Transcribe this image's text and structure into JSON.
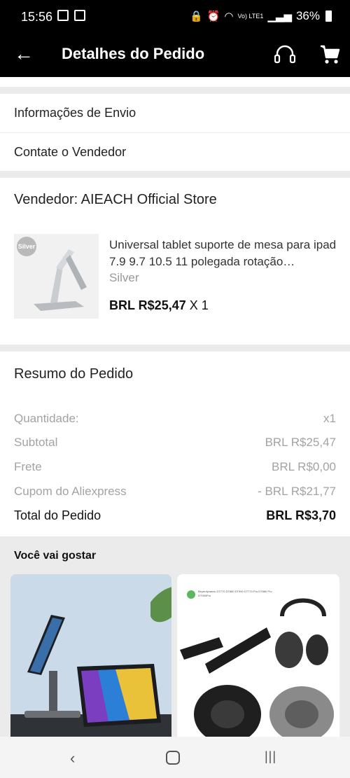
{
  "status_bar": {
    "time": "15:56",
    "signal_label": "Vo) LTE1",
    "battery": "36%"
  },
  "app_bar": {
    "title": "Detalhes do Pedido",
    "icons": [
      "back-arrow-icon",
      "headset-icon",
      "cart-icon"
    ]
  },
  "nav_rows": {
    "shipping": "Informações de Envio",
    "contact": "Contate o Vendedor"
  },
  "order_item": {
    "seller": "Vendedor: AIEACH Official Store",
    "thumb_badge": "Silver",
    "title": "Universal tablet suporte de mesa para ipad 7.9 9.7 10.5 11 polegada rotação…",
    "variant": "Silver",
    "price": "BRL R$25,47",
    "quantity": "X 1"
  },
  "summary": {
    "title": "Resumo do Pedido",
    "rows": [
      {
        "label": "Quantidade:",
        "value": "x1"
      },
      {
        "label": "Subtotal",
        "value": "BRL R$25,47"
      },
      {
        "label": "Frete",
        "value": "BRL R$0,00"
      },
      {
        "label": "Cupom do Aliexpress",
        "value": "- BRL R$21,77"
      }
    ],
    "total": {
      "label": "Total do Pedido",
      "value": "BRL R$3,70"
    }
  },
  "recommendations": {
    "title": "Você vai gostar",
    "card2_caption": "Beyerdynamic DT770 DT880 DT990 DT770 Pro DT880 Pro DT990Pro"
  },
  "colors": {
    "appbar_bg": "#000000",
    "page_bg": "#ebebeb",
    "card_bg": "#ffffff",
    "muted_text": "#a3a3a3"
  }
}
